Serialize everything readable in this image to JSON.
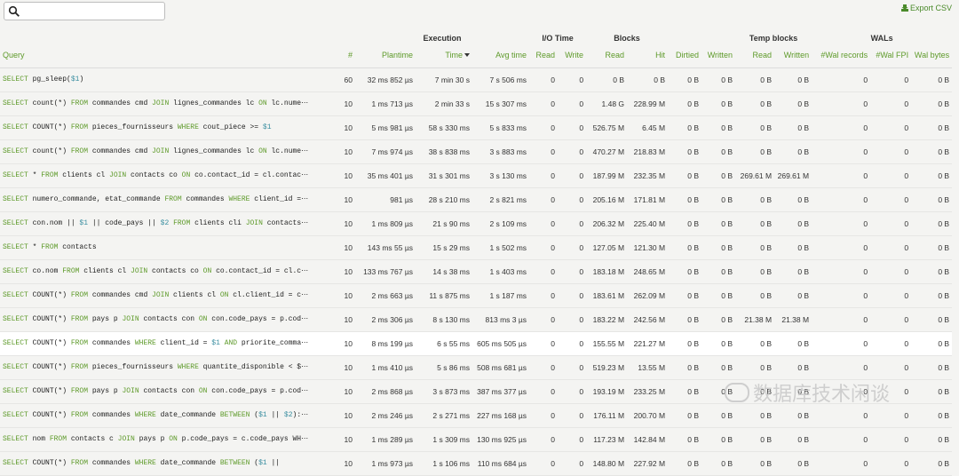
{
  "search": {
    "value": "",
    "placeholder": ""
  },
  "toolbar": {
    "export_label": "Export CSV"
  },
  "groups": {
    "execution": "Execution",
    "io_time": "I/O Time",
    "blocks": "Blocks",
    "temp_blocks": "Temp blocks",
    "wals": "WALs"
  },
  "columns": {
    "query": "Query",
    "calls": "#",
    "plantime": "Plantime",
    "time": "Time",
    "avg_time": "Avg time",
    "io_read": "Read",
    "io_write": "Write",
    "blk_read": "Read",
    "blk_hit": "Hit",
    "blk_dirtied": "Dirtied",
    "blk_written": "Written",
    "tmp_read": "Read",
    "tmp_written": "Written",
    "wal_records": "#Wal records",
    "wal_fpi": "#Wal FPI",
    "wal_bytes": "Wal bytes"
  },
  "rows": [
    {
      "q": [
        [
          "f",
          "SELECT"
        ],
        [
          "t",
          " pg_sleep("
        ],
        [
          "p",
          "$1"
        ],
        [
          "t",
          ")"
        ]
      ],
      "calls": "60",
      "plan": "32 ms 852 µs",
      "time": "7 min 30 s",
      "avg": "7 s 506 ms",
      "ior": "0",
      "iow": "0",
      "br": "0 B",
      "bh": "0 B",
      "bd": "0 B",
      "bw": "0 B",
      "tr": "0 B",
      "tw": "0 B",
      "wr": "0",
      "wf": "0",
      "wb": "0 B"
    },
    {
      "q": [
        [
          "f",
          "SELECT"
        ],
        [
          "t",
          " count(*) "
        ],
        [
          "f",
          "FROM"
        ],
        [
          "t",
          " commandes cmd "
        ],
        [
          "f",
          "JOIN"
        ],
        [
          "t",
          " lignes_commandes lc "
        ],
        [
          "f",
          "ON"
        ],
        [
          "t",
          " lc.nume⋯"
        ]
      ],
      "calls": "10",
      "plan": "1 ms 713 µs",
      "time": "2 min 33 s",
      "avg": "15 s 307 ms",
      "ior": "0",
      "iow": "0",
      "br": "1.48 G",
      "bh": "228.99 M",
      "bd": "0 B",
      "bw": "0 B",
      "tr": "0 B",
      "tw": "0 B",
      "wr": "0",
      "wf": "0",
      "wb": "0 B"
    },
    {
      "q": [
        [
          "f",
          "SELECT"
        ],
        [
          "t",
          " COUNT(*) "
        ],
        [
          "f",
          "FROM"
        ],
        [
          "t",
          " pieces_fournisseurs "
        ],
        [
          "f",
          "WHERE"
        ],
        [
          "t",
          " cout_piece >= "
        ],
        [
          "p",
          "$1"
        ]
      ],
      "calls": "10",
      "plan": "5 ms 981 µs",
      "time": "58 s 330 ms",
      "avg": "5 s 833 ms",
      "ior": "0",
      "iow": "0",
      "br": "526.75 M",
      "bh": "6.45 M",
      "bd": "0 B",
      "bw": "0 B",
      "tr": "0 B",
      "tw": "0 B",
      "wr": "0",
      "wf": "0",
      "wb": "0 B"
    },
    {
      "q": [
        [
          "f",
          "SELECT"
        ],
        [
          "t",
          " count(*) "
        ],
        [
          "f",
          "FROM"
        ],
        [
          "t",
          " commandes cmd "
        ],
        [
          "f",
          "JOIN"
        ],
        [
          "t",
          " lignes_commandes lc "
        ],
        [
          "f",
          "ON"
        ],
        [
          "t",
          " lc.nume⋯"
        ]
      ],
      "calls": "10",
      "plan": "7 ms 974 µs",
      "time": "38 s 838 ms",
      "avg": "3 s 883 ms",
      "ior": "0",
      "iow": "0",
      "br": "470.27 M",
      "bh": "218.83 M",
      "bd": "0 B",
      "bw": "0 B",
      "tr": "0 B",
      "tw": "0 B",
      "wr": "0",
      "wf": "0",
      "wb": "0 B"
    },
    {
      "q": [
        [
          "f",
          "SELECT"
        ],
        [
          "t",
          " * "
        ],
        [
          "f",
          "FROM"
        ],
        [
          "t",
          " clients cl "
        ],
        [
          "f",
          "JOIN"
        ],
        [
          "t",
          " contacts co "
        ],
        [
          "f",
          "ON"
        ],
        [
          "t",
          " co.contact_id = cl.contac⋯"
        ]
      ],
      "calls": "10",
      "plan": "35 ms 401 µs",
      "time": "31 s 301 ms",
      "avg": "3 s 130 ms",
      "ior": "0",
      "iow": "0",
      "br": "187.99 M",
      "bh": "232.35 M",
      "bd": "0 B",
      "bw": "0 B",
      "tr": "269.61 M",
      "tw": "269.61 M",
      "wr": "0",
      "wf": "0",
      "wb": "0 B"
    },
    {
      "q": [
        [
          "f",
          "SELECT"
        ],
        [
          "t",
          " numero_commande, etat_commande "
        ],
        [
          "f",
          "FROM"
        ],
        [
          "t",
          " commandes "
        ],
        [
          "f",
          "WHERE"
        ],
        [
          "t",
          " client_id =⋯"
        ]
      ],
      "calls": "10",
      "plan": "981 µs",
      "time": "28 s 210 ms",
      "avg": "2 s 821 ms",
      "ior": "0",
      "iow": "0",
      "br": "205.16 M",
      "bh": "171.81 M",
      "bd": "0 B",
      "bw": "0 B",
      "tr": "0 B",
      "tw": "0 B",
      "wr": "0",
      "wf": "0",
      "wb": "0 B"
    },
    {
      "q": [
        [
          "f",
          "SELECT"
        ],
        [
          "t",
          " con.nom || "
        ],
        [
          "p",
          "$1"
        ],
        [
          "t",
          " || code_pays || "
        ],
        [
          "p",
          "$2"
        ],
        [
          "t",
          " "
        ],
        [
          "f",
          "FROM"
        ],
        [
          "t",
          " clients cli "
        ],
        [
          "f",
          "JOIN"
        ],
        [
          "t",
          " contacts⋯"
        ]
      ],
      "calls": "10",
      "plan": "1 ms 809 µs",
      "time": "21 s 90 ms",
      "avg": "2 s 109 ms",
      "ior": "0",
      "iow": "0",
      "br": "206.32 M",
      "bh": "225.40 M",
      "bd": "0 B",
      "bw": "0 B",
      "tr": "0 B",
      "tw": "0 B",
      "wr": "0",
      "wf": "0",
      "wb": "0 B"
    },
    {
      "q": [
        [
          "f",
          "SELECT"
        ],
        [
          "t",
          " * "
        ],
        [
          "f",
          "FROM"
        ],
        [
          "t",
          " contacts"
        ]
      ],
      "calls": "10",
      "plan": "143 ms 55 µs",
      "time": "15 s 29 ms",
      "avg": "1 s 502 ms",
      "ior": "0",
      "iow": "0",
      "br": "127.05 M",
      "bh": "121.30 M",
      "bd": "0 B",
      "bw": "0 B",
      "tr": "0 B",
      "tw": "0 B",
      "wr": "0",
      "wf": "0",
      "wb": "0 B"
    },
    {
      "q": [
        [
          "f",
          "SELECT"
        ],
        [
          "t",
          " co.nom "
        ],
        [
          "f",
          "FROM"
        ],
        [
          "t",
          " clients cl "
        ],
        [
          "f",
          "JOIN"
        ],
        [
          "t",
          " contacts co "
        ],
        [
          "f",
          "ON"
        ],
        [
          "t",
          " co.contact_id = cl.c⋯"
        ]
      ],
      "calls": "10",
      "plan": "133 ms 767 µs",
      "time": "14 s 38 ms",
      "avg": "1 s 403 ms",
      "ior": "0",
      "iow": "0",
      "br": "183.18 M",
      "bh": "248.65 M",
      "bd": "0 B",
      "bw": "0 B",
      "tr": "0 B",
      "tw": "0 B",
      "wr": "0",
      "wf": "0",
      "wb": "0 B"
    },
    {
      "q": [
        [
          "f",
          "SELECT"
        ],
        [
          "t",
          " COUNT(*) "
        ],
        [
          "f",
          "FROM"
        ],
        [
          "t",
          " commandes cmd "
        ],
        [
          "f",
          "JOIN"
        ],
        [
          "t",
          " clients cl "
        ],
        [
          "f",
          "ON"
        ],
        [
          "t",
          " cl.client_id = c⋯"
        ]
      ],
      "calls": "10",
      "plan": "2 ms 663 µs",
      "time": "11 s 875 ms",
      "avg": "1 s 187 ms",
      "ior": "0",
      "iow": "0",
      "br": "183.61 M",
      "bh": "262.09 M",
      "bd": "0 B",
      "bw": "0 B",
      "tr": "0 B",
      "tw": "0 B",
      "wr": "0",
      "wf": "0",
      "wb": "0 B"
    },
    {
      "q": [
        [
          "f",
          "SELECT"
        ],
        [
          "t",
          " COUNT(*) "
        ],
        [
          "f",
          "FROM"
        ],
        [
          "t",
          " pays p "
        ],
        [
          "f",
          "JOIN"
        ],
        [
          "t",
          " contacts con "
        ],
        [
          "f",
          "ON"
        ],
        [
          "t",
          " con.code_pays = p.cod⋯"
        ]
      ],
      "calls": "10",
      "plan": "2 ms 306 µs",
      "time": "8 s 130 ms",
      "avg": "813 ms 3 µs",
      "ior": "0",
      "iow": "0",
      "br": "183.22 M",
      "bh": "242.56 M",
      "bd": "0 B",
      "bw": "0 B",
      "tr": "21.38 M",
      "tw": "21.38 M",
      "wr": "0",
      "wf": "0",
      "wb": "0 B"
    },
    {
      "q": [
        [
          "f",
          "SELECT"
        ],
        [
          "t",
          " COUNT(*) "
        ],
        [
          "f",
          "FROM"
        ],
        [
          "t",
          " commandes "
        ],
        [
          "f",
          "WHERE"
        ],
        [
          "t",
          " client_id = "
        ],
        [
          "p",
          "$1"
        ],
        [
          "t",
          " "
        ],
        [
          "f",
          "AND"
        ],
        [
          "t",
          " priorite_comma⋯"
        ]
      ],
      "calls": "10",
      "plan": "8 ms 199 µs",
      "time": "6 s 55 ms",
      "avg": "605 ms 505 µs",
      "ior": "0",
      "iow": "0",
      "br": "155.55 M",
      "bh": "221.27 M",
      "bd": "0 B",
      "bw": "0 B",
      "tr": "0 B",
      "tw": "0 B",
      "wr": "0",
      "wf": "0",
      "wb": "0 B",
      "hl": true
    },
    {
      "q": [
        [
          "f",
          "SELECT"
        ],
        [
          "t",
          " COUNT(*) "
        ],
        [
          "f",
          "FROM"
        ],
        [
          "t",
          " pieces_fournisseurs "
        ],
        [
          "f",
          "WHERE"
        ],
        [
          "t",
          " quantite_disponible < $⋯"
        ]
      ],
      "calls": "10",
      "plan": "1 ms 410 µs",
      "time": "5 s 86 ms",
      "avg": "508 ms 681 µs",
      "ior": "0",
      "iow": "0",
      "br": "519.23 M",
      "bh": "13.55 M",
      "bd": "0 B",
      "bw": "0 B",
      "tr": "0 B",
      "tw": "0 B",
      "wr": "0",
      "wf": "0",
      "wb": "0 B"
    },
    {
      "q": [
        [
          "f",
          "SELECT"
        ],
        [
          "t",
          " COUNT(*) "
        ],
        [
          "f",
          "FROM"
        ],
        [
          "t",
          " pays p "
        ],
        [
          "f",
          "JOIN"
        ],
        [
          "t",
          " contacts con "
        ],
        [
          "f",
          "ON"
        ],
        [
          "t",
          " con.code_pays = p.cod⋯"
        ]
      ],
      "calls": "10",
      "plan": "2 ms 868 µs",
      "time": "3 s 873 ms",
      "avg": "387 ms 377 µs",
      "ior": "0",
      "iow": "0",
      "br": "193.19 M",
      "bh": "233.25 M",
      "bd": "0 B",
      "bw": "0 B",
      "tr": "0 B",
      "tw": "0 B",
      "wr": "0",
      "wf": "0",
      "wb": "0 B"
    },
    {
      "q": [
        [
          "f",
          "SELECT"
        ],
        [
          "t",
          " COUNT(*) "
        ],
        [
          "f",
          "FROM"
        ],
        [
          "t",
          " commandes "
        ],
        [
          "f",
          "WHERE"
        ],
        [
          "t",
          " date_commande "
        ],
        [
          "f",
          "BETWEEN"
        ],
        [
          "t",
          " ("
        ],
        [
          "p",
          "$1"
        ],
        [
          "t",
          " || "
        ],
        [
          "p",
          "$2"
        ],
        [
          "t",
          "):⋯"
        ]
      ],
      "calls": "10",
      "plan": "2 ms 246 µs",
      "time": "2 s 271 ms",
      "avg": "227 ms 168 µs",
      "ior": "0",
      "iow": "0",
      "br": "176.11 M",
      "bh": "200.70 M",
      "bd": "0 B",
      "bw": "0 B",
      "tr": "0 B",
      "tw": "0 B",
      "wr": "0",
      "wf": "0",
      "wb": "0 B"
    },
    {
      "q": [
        [
          "f",
          "SELECT"
        ],
        [
          "t",
          " nom "
        ],
        [
          "f",
          "FROM"
        ],
        [
          "t",
          " contacts c "
        ],
        [
          "f",
          "JOIN"
        ],
        [
          "t",
          " pays p "
        ],
        [
          "f",
          "ON"
        ],
        [
          "t",
          " p.code_pays = c.code_pays WH⋯"
        ]
      ],
      "calls": "10",
      "plan": "1 ms 289 µs",
      "time": "1 s 309 ms",
      "avg": "130 ms 925 µs",
      "ior": "0",
      "iow": "0",
      "br": "117.23 M",
      "bh": "142.84 M",
      "bd": "0 B",
      "bw": "0 B",
      "tr": "0 B",
      "tw": "0 B",
      "wr": "0",
      "wf": "0",
      "wb": "0 B"
    },
    {
      "q": [
        [
          "f",
          "SELECT"
        ],
        [
          "t",
          " COUNT(*) "
        ],
        [
          "f",
          "FROM"
        ],
        [
          "t",
          " commandes "
        ],
        [
          "f",
          "WHERE"
        ],
        [
          "t",
          " date_commande "
        ],
        [
          "f",
          "BETWEEN"
        ],
        [
          "t",
          " ("
        ],
        [
          "p",
          "$1"
        ],
        [
          "t",
          " ||"
        ]
      ],
      "calls": "10",
      "plan": "1 ms 973 µs",
      "time": "1 s 106 ms",
      "avg": "110 ms 684 µs",
      "ior": "0",
      "iow": "0",
      "br": "148.80 M",
      "bh": "227.92 M",
      "bd": "0 B",
      "bw": "0 B",
      "tr": "0 B",
      "tw": "0 B",
      "wr": "0",
      "wf": "0",
      "wb": "0 B"
    }
  ],
  "watermark": {
    "text": "数据库技术闲谈"
  },
  "colors": {
    "accent": "#5e9a2a",
    "param": "#3a8ea0"
  }
}
